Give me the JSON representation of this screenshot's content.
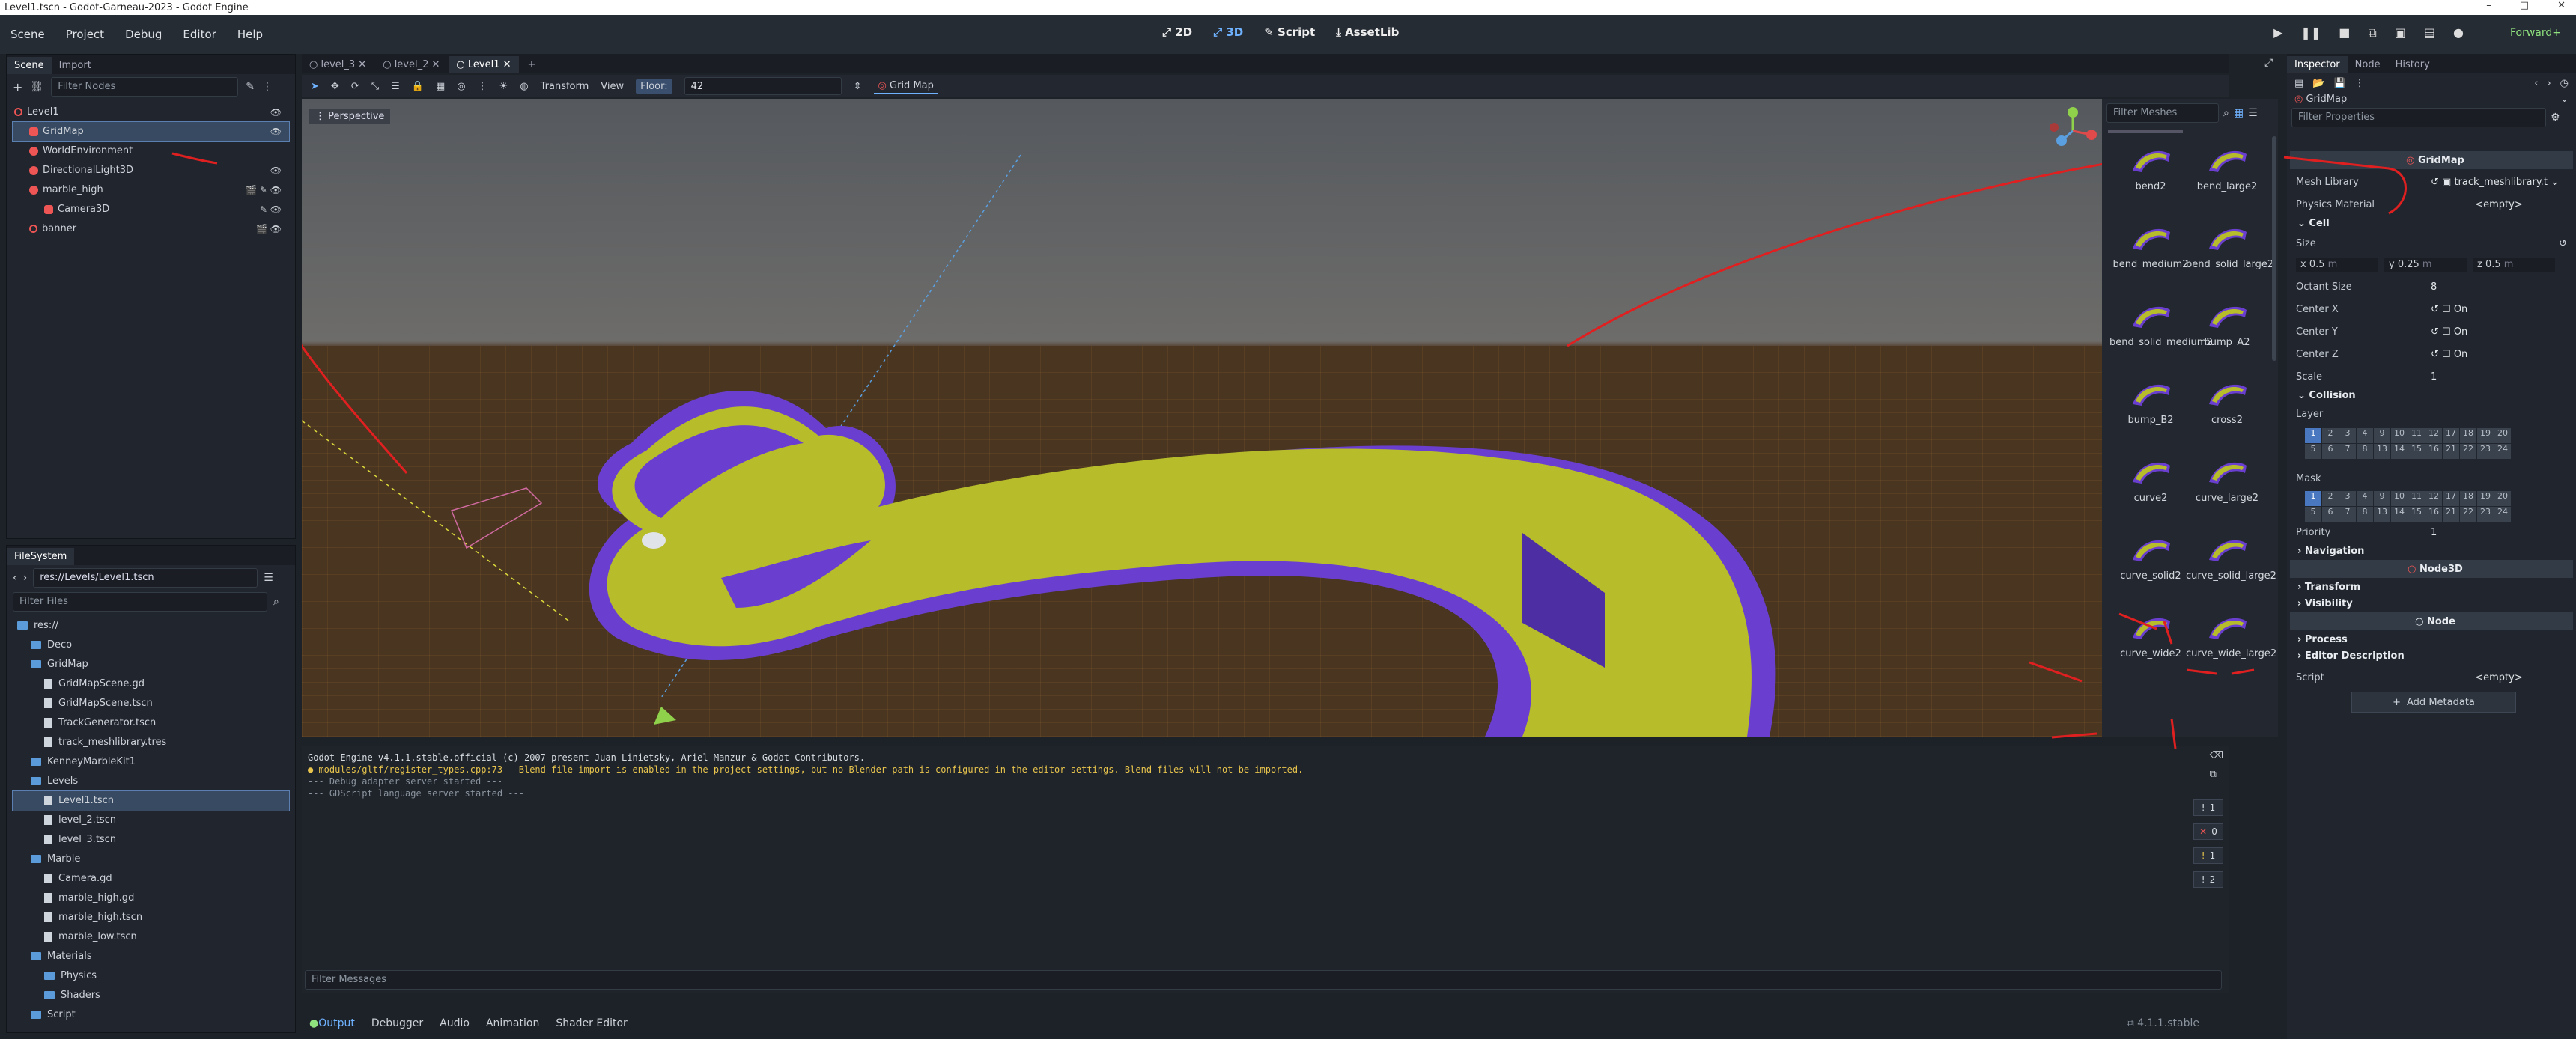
{
  "window": {
    "title": "Level1.tscn - Godot-Garneau-2023 - Godot Engine",
    "controls": [
      "–",
      "□",
      "✕"
    ]
  },
  "menu": [
    "Scene",
    "Project",
    "Debug",
    "Editor",
    "Help"
  ],
  "modes": [
    "2D",
    "3D",
    "Script",
    "AssetLib"
  ],
  "renderer": "Forward+",
  "scene_panel": {
    "tabs": [
      "Scene",
      "Import"
    ],
    "filter_placeholder": "Filter Nodes",
    "nodes": [
      {
        "label": "Level1",
        "depth": 0
      },
      {
        "label": "GridMap",
        "depth": 1,
        "selected": true
      },
      {
        "label": "WorldEnvironment",
        "depth": 1
      },
      {
        "label": "DirectionalLight3D",
        "depth": 1
      },
      {
        "label": "marble_high",
        "depth": 1
      },
      {
        "label": "Camera3D",
        "depth": 2
      },
      {
        "label": "banner",
        "depth": 1
      }
    ]
  },
  "filesystem": {
    "tab": "FileSystem",
    "path": "res://Levels/Level1.tscn",
    "filter_placeholder": "Filter Files",
    "items": [
      {
        "label": "res://",
        "kind": "folder",
        "depth": 0
      },
      {
        "label": "Deco",
        "kind": "folder",
        "depth": 1
      },
      {
        "label": "GridMap",
        "kind": "folder",
        "depth": 1
      },
      {
        "label": "GridMapScene.gd",
        "kind": "file",
        "depth": 2
      },
      {
        "label": "GridMapScene.tscn",
        "kind": "file",
        "depth": 2
      },
      {
        "label": "TrackGenerator.tscn",
        "kind": "file",
        "depth": 2
      },
      {
        "label": "track_meshlibrary.tres",
        "kind": "file",
        "depth": 2
      },
      {
        "label": "KenneyMarbleKit1",
        "kind": "folder",
        "depth": 1
      },
      {
        "label": "Levels",
        "kind": "folder",
        "depth": 1
      },
      {
        "label": "Level1.tscn",
        "kind": "file",
        "depth": 2,
        "selected": true
      },
      {
        "label": "level_2.tscn",
        "kind": "file",
        "depth": 2
      },
      {
        "label": "level_3.tscn",
        "kind": "file",
        "depth": 2
      },
      {
        "label": "Marble",
        "kind": "folder",
        "depth": 1
      },
      {
        "label": "Camera.gd",
        "kind": "file",
        "depth": 2
      },
      {
        "label": "marble_high.gd",
        "kind": "file",
        "depth": 2
      },
      {
        "label": "marble_high.tscn",
        "kind": "file",
        "depth": 2
      },
      {
        "label": "marble_low.tscn",
        "kind": "file",
        "depth": 2
      },
      {
        "label": "Materials",
        "kind": "folder",
        "depth": 1
      },
      {
        "label": "Physics",
        "kind": "folder",
        "depth": 2
      },
      {
        "label": "Shaders",
        "kind": "folder",
        "depth": 2
      },
      {
        "label": "Script",
        "kind": "folder",
        "depth": 1
      }
    ]
  },
  "editor_tabs": [
    "level_3",
    "level_2",
    "Level1"
  ],
  "viewport_toolbar": {
    "transform": "Transform",
    "view": "View",
    "floor_label": "Floor:",
    "floor_value": "42",
    "gridmap_button": "Grid Map"
  },
  "viewport": {
    "perspective": "Perspective"
  },
  "mesh_panel": {
    "filter_placeholder": "Filter Meshes",
    "meshes": [
      "bend2",
      "bend_large2",
      "bend_medium2",
      "bend_solid_large2",
      "bend_solid_medium2",
      "bump_A2",
      "bump_B2",
      "cross2",
      "curve2",
      "curve_large2",
      "curve_solid2",
      "curve_solid_large2",
      "curve_wide2",
      "curve_wide_large2"
    ]
  },
  "console": {
    "lines": [
      {
        "text": "Godot Engine v4.1.1.stable.official (c) 2007-present Juan Linietsky, Ariel Manzur & Godot Contributors.",
        "kind": "normal"
      },
      {
        "text": "● modules/gltf/register_types.cpp:73 - Blend file import is enabled in the project settings, but no Blender path is configured in the editor settings. Blend files will not be imported.",
        "kind": "warn"
      },
      {
        "text": "--- Debug adapter server started ---",
        "kind": "dim"
      },
      {
        "text": "--- GDScript language server started ---",
        "kind": "dim"
      }
    ],
    "filter_placeholder": "Filter Messages",
    "counts": [
      "1",
      "0",
      "1",
      "2"
    ]
  },
  "bottom_tabs": [
    "Output",
    "Debugger",
    "Audio",
    "Animation",
    "Shader Editor"
  ],
  "version": "4.1.1.stable",
  "inspector": {
    "tabs": [
      "Inspector",
      "Node",
      "History"
    ],
    "object": "GridMap",
    "filter_placeholder": "Filter Properties",
    "class_header": "GridMap",
    "mesh_library_label": "Mesh Library",
    "mesh_library_value": "track_meshlibrary.t",
    "physics_material_label": "Physics Material",
    "physics_material_value": "<empty>",
    "cell_section": "Cell",
    "size_label": "Size",
    "size_x": "0.5",
    "size_y": "0.25",
    "size_z": "0.5",
    "size_unit": "m",
    "octant_label": "Octant Size",
    "octant_value": "8",
    "center_x": "Center X",
    "center_y": "Center Y",
    "center_z": "Center Z",
    "on": "On",
    "scale_label": "Scale",
    "scale_value": "1",
    "collision_section": "Collision",
    "layer_label": "Layer",
    "mask_label": "Mask",
    "priority_label": "Priority",
    "priority_value": "1",
    "navigation": "Navigation",
    "node3d_header": "Node3D",
    "transform": "Transform",
    "visibility": "Visibility",
    "node_header": "Node",
    "process": "Process",
    "editor_description": "Editor Description",
    "script_label": "Script",
    "script_value": "<empty>",
    "add_metadata": "Add Metadata"
  },
  "colors": {
    "accent": "#6fb2ff",
    "track_yellow": "#b7bd2a",
    "track_purple": "#6a3fd0",
    "annotation_red": "#e02020"
  }
}
